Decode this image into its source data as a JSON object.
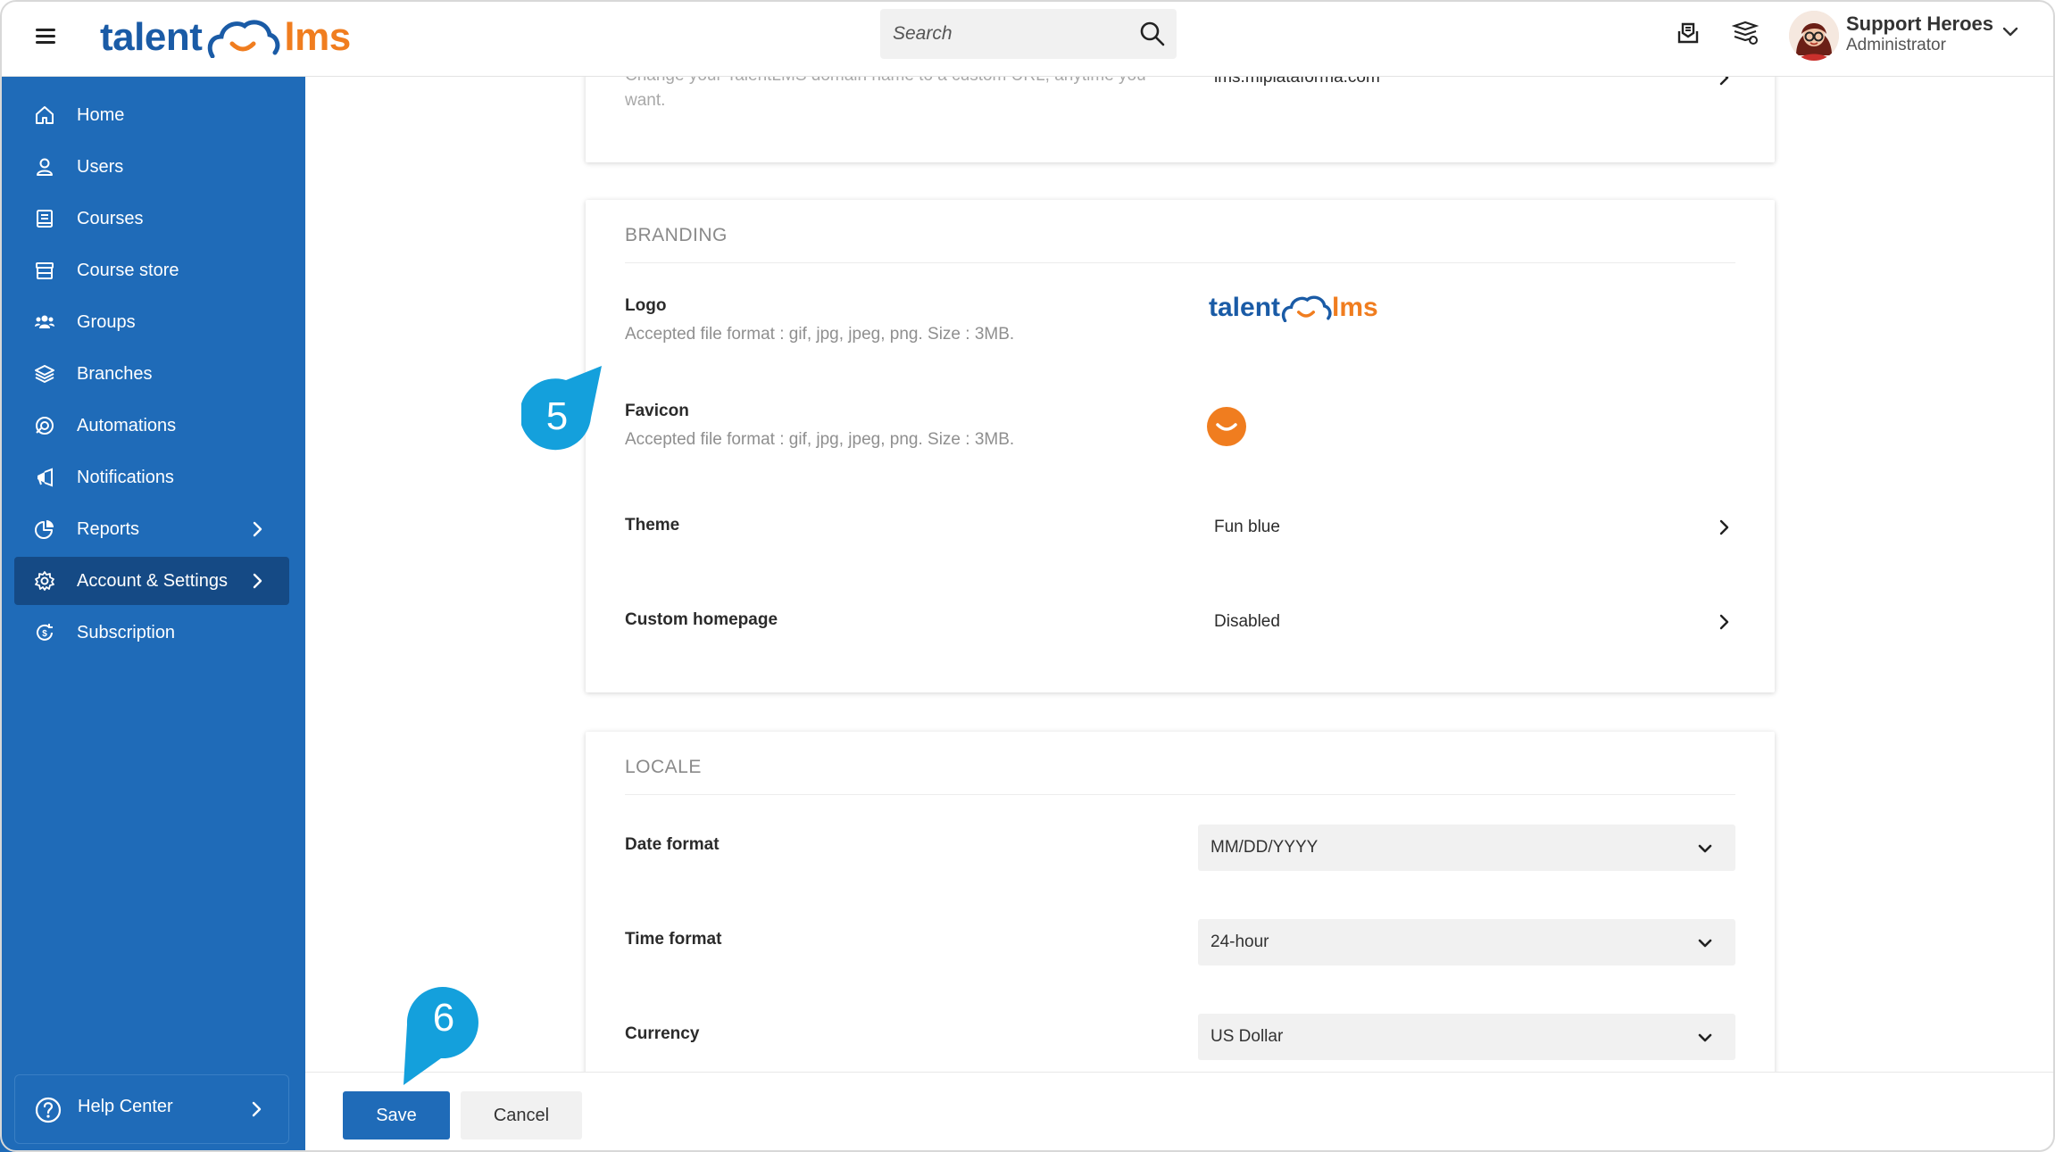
{
  "topbar": {
    "logo_left": "talent",
    "logo_right": "lms",
    "search_placeholder": "Search",
    "user_name": "Support Heroes",
    "user_role": "Administrator"
  },
  "sidebar": {
    "items": [
      {
        "label": "Home",
        "icon": "home-icon"
      },
      {
        "label": "Users",
        "icon": "user-icon"
      },
      {
        "label": "Courses",
        "icon": "book-icon"
      },
      {
        "label": "Course store",
        "icon": "store-icon"
      },
      {
        "label": "Groups",
        "icon": "groups-icon"
      },
      {
        "label": "Branches",
        "icon": "layers-icon"
      },
      {
        "label": "Automations",
        "icon": "automation-icon"
      },
      {
        "label": "Notifications",
        "icon": "megaphone-icon"
      },
      {
        "label": "Reports",
        "icon": "pie-chart-icon"
      },
      {
        "label": "Account & Settings",
        "icon": "gear-icon"
      },
      {
        "label": "Subscription",
        "icon": "subscription-icon"
      }
    ],
    "help_label": "Help Center"
  },
  "domain_card": {
    "description_line1": "Change your TalentLMS domain name to a custom URL, anytime you",
    "description_line2": "want.",
    "value": "lms.miplataforma.com"
  },
  "branding": {
    "title": "BRANDING",
    "logo_label": "Logo",
    "logo_sub": "Accepted file format : gif, jpg, jpeg, png. Size : 3MB.",
    "logo_preview_left": "talent",
    "logo_preview_right": "lms",
    "favicon_label": "Favicon",
    "favicon_sub": "Accepted file format : gif, jpg, jpeg, png. Size : 3MB.",
    "theme_label": "Theme",
    "theme_value": "Fun blue",
    "homepage_label": "Custom homepage",
    "homepage_value": "Disabled"
  },
  "locale": {
    "title": "LOCALE",
    "date_label": "Date format",
    "date_value": "MM/DD/YYYY",
    "time_label": "Time format",
    "time_value": "24-hour",
    "currency_label": "Currency",
    "currency_value": "US Dollar"
  },
  "footer": {
    "save_label": "Save",
    "cancel_label": "Cancel"
  },
  "markers": {
    "step5": "5",
    "step6": "6"
  },
  "colors": {
    "sidebar": "#1f6bb8",
    "sidebar_active": "#154a85",
    "brand_blue": "#1a5ba6",
    "brand_orange": "#f07d1f",
    "marker": "#14a0dc"
  }
}
